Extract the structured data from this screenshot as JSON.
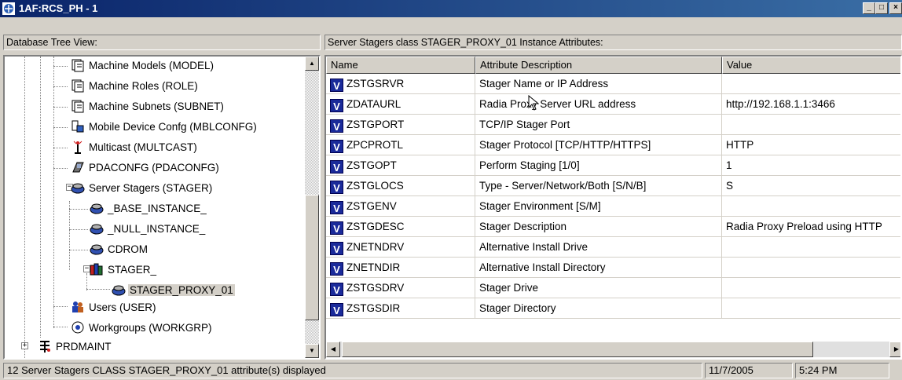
{
  "window": {
    "title": "1AF:RCS_PH - 1",
    "min": "_",
    "max": "□",
    "close": "×"
  },
  "left_header": "Database Tree View:",
  "right_header": "Server Stagers class STAGER_PROXY_01 Instance Attributes:",
  "tree": [
    {
      "label": "Machine Models (MODEL)",
      "icon": "class-icon"
    },
    {
      "label": "Machine Roles (ROLE)",
      "icon": "class-icon"
    },
    {
      "label": "Machine Subnets (SUBNET)",
      "icon": "class-icon"
    },
    {
      "label": "Mobile Device Confg (MBLCONFG)",
      "icon": "mobile-device-icon"
    },
    {
      "label": "Multicast (MULTCAST)",
      "icon": "antenna-icon"
    },
    {
      "label": "PDACONFG (PDACONFG)",
      "icon": "pda-icon"
    },
    {
      "label": "Server Stagers (STAGER)",
      "icon": "stager-icon"
    },
    {
      "label": "_BASE_INSTANCE_",
      "icon": "stager-icon"
    },
    {
      "label": "_NULL_INSTANCE_",
      "icon": "stager-icon"
    },
    {
      "label": "CDROM",
      "icon": "stager-icon"
    },
    {
      "label": "STAGER_",
      "icon": "books-icon"
    },
    {
      "label": "STAGER_PROXY_01",
      "icon": "stager-icon"
    },
    {
      "label": "Users (USER)",
      "icon": "users-icon"
    },
    {
      "label": "Workgroups (WORKGRP)",
      "icon": "workgroup-icon"
    },
    {
      "label": "PRDMAINT",
      "icon": "prdmaint-icon"
    }
  ],
  "columns": [
    "Name",
    "Attribute Description",
    "Value"
  ],
  "badge": "V",
  "rows": [
    {
      "name": "ZSTGSRVR",
      "desc": "Stager Name or IP Address",
      "value": ""
    },
    {
      "name": "ZDATAURL",
      "desc": "Radia Proxy Server URL address",
      "value": "http://192.168.1.1:3466"
    },
    {
      "name": "ZSTGPORT",
      "desc": "TCP/IP Stager Port",
      "value": ""
    },
    {
      "name": "ZPCPROTL",
      "desc": "Stager Protocol [TCP/HTTP/HTTPS]",
      "value": "HTTP"
    },
    {
      "name": "ZSTGOPT",
      "desc": "Perform Staging [1/0]",
      "value": "1"
    },
    {
      "name": "ZSTGLOCS",
      "desc": "Type - Server/Network/Both [S/N/B]",
      "value": "S"
    },
    {
      "name": "ZSTGENV",
      "desc": "Stager Environment [S/M]",
      "value": ""
    },
    {
      "name": "ZSTGDESC",
      "desc": "Stager Description",
      "value": "Radia Proxy Preload using HTTP"
    },
    {
      "name": "ZNETNDRV",
      "desc": "Alternative Install Drive",
      "value": ""
    },
    {
      "name": "ZNETNDIR",
      "desc": "Alternative Install Directory",
      "value": ""
    },
    {
      "name": "ZSTGSDRV",
      "desc": "Stager Drive",
      "value": ""
    },
    {
      "name": "ZSTGSDIR",
      "desc": "Stager Directory",
      "value": ""
    }
  ],
  "status": {
    "message": "12 Server Stagers CLASS STAGER_PROXY_01 attribute(s) displayed",
    "date": "11/7/2005",
    "time": "5:24 PM"
  },
  "colors": {
    "title_start": "#0a246a",
    "title_end": "#3a6ea5",
    "badge": "#1a2a9a",
    "face": "#d4d0c8"
  }
}
